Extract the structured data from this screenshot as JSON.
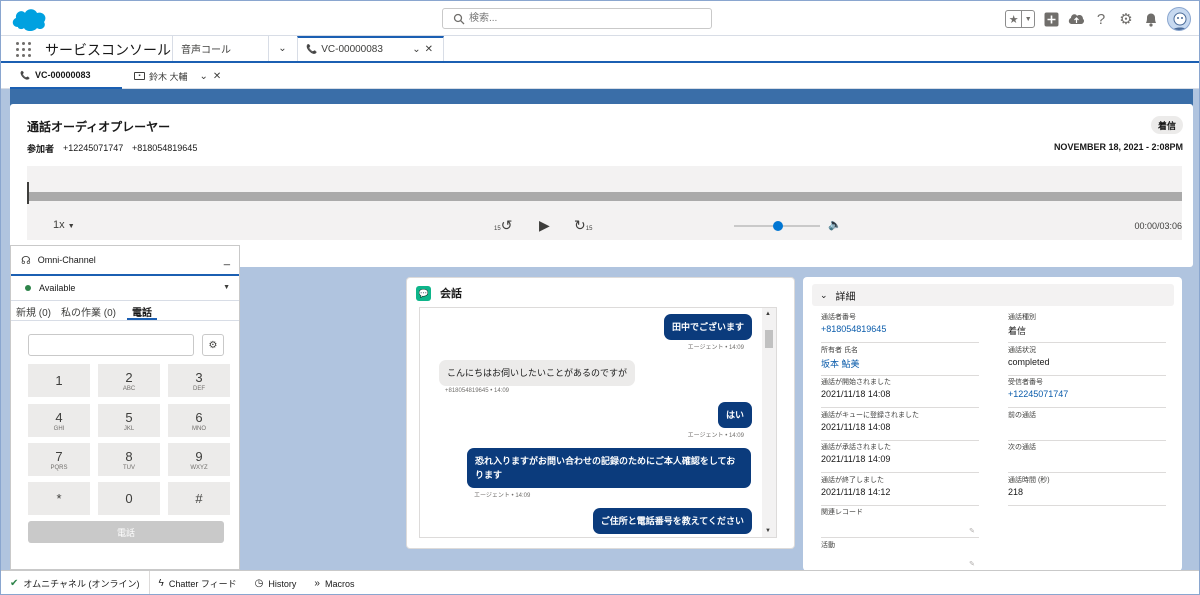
{
  "header": {
    "search_placeholder": "検索..."
  },
  "appnav": {
    "app_name": "サービスコンソール",
    "tabs": [
      {
        "label": "音声コール"
      },
      {
        "label": "VC-00000083"
      }
    ]
  },
  "subtabs": [
    {
      "label": "VC-00000083"
    },
    {
      "label": "鈴木 大輔"
    }
  ],
  "player": {
    "title": "通話オーディオプレーヤー",
    "badge": "着信",
    "participants_label": "参加者",
    "participants": [
      "+12245071747",
      "+818054819645"
    ],
    "date": "NOVEMBER 18, 2021 - 2:08PM",
    "speed": "1x",
    "skip_back": "15",
    "skip_forward": "15",
    "time": "00:00/03:06",
    "progress": 0,
    "volume": 0.5
  },
  "omni": {
    "title": "Omni-Channel",
    "status": "Available",
    "tabs": [
      "新規 (0)",
      "私の作業 (0)",
      "電話"
    ],
    "keys": [
      {
        "digit": "1",
        "letters": ""
      },
      {
        "digit": "2",
        "letters": "ABC"
      },
      {
        "digit": "3",
        "letters": "DEF"
      },
      {
        "digit": "4",
        "letters": "GHI"
      },
      {
        "digit": "5",
        "letters": "JKL"
      },
      {
        "digit": "6",
        "letters": "MNO"
      },
      {
        "digit": "7",
        "letters": "PQRS"
      },
      {
        "digit": "8",
        "letters": "TUV"
      },
      {
        "digit": "9",
        "letters": "WXYZ"
      },
      {
        "digit": "*",
        "letters": ""
      },
      {
        "digit": "0",
        "letters": ""
      },
      {
        "digit": "#",
        "letters": ""
      }
    ],
    "call_label": "電話"
  },
  "conversation": {
    "title": "会話",
    "messages": [
      {
        "dir": "out",
        "text": "田中でございます",
        "meta": "エージェント • 14:09"
      },
      {
        "dir": "in",
        "text": "こんにちはお伺いしたいことがあるのですが",
        "meta": "+818054819645 • 14:09"
      },
      {
        "dir": "out",
        "text": "はい",
        "meta": "エージェント • 14:09"
      },
      {
        "dir": "out",
        "text": "恐れ入りますがお問い合わせの記録のためにご本人確認をしております",
        "meta": "エージェント • 14:09"
      },
      {
        "dir": "out",
        "text": "ご住所と電話番号を教えてください",
        "meta": ""
      }
    ]
  },
  "details": {
    "section": "詳細",
    "left": [
      {
        "label": "通話者番号",
        "value": "+818054819645",
        "link": true
      },
      {
        "label": "所有者 氏名",
        "value": "坂本 鮎美",
        "link": true
      },
      {
        "label": "通話が開始されました",
        "value": "2021/11/18 14:08"
      },
      {
        "label": "通話がキューに登録されました",
        "value": "2021/11/18 14:08"
      },
      {
        "label": "通話が承話されました",
        "value": "2021/11/18 14:09"
      },
      {
        "label": "通話が終了しました",
        "value": "2021/11/18 14:12"
      },
      {
        "label": "関連レコード",
        "value": ""
      },
      {
        "label": "活動",
        "value": ""
      }
    ],
    "right": [
      {
        "label": "通話種別",
        "value": "着信"
      },
      {
        "label": "通話状況",
        "value": "completed"
      },
      {
        "label": "受信者番号",
        "value": "+12245071747",
        "link": true
      },
      {
        "label": "前の通話",
        "value": ""
      },
      {
        "label": "次の通話",
        "value": ""
      },
      {
        "label": "通話時間 (秒)",
        "value": "218"
      }
    ]
  },
  "utility": [
    {
      "label": "オムニチャネル (オンライン)",
      "icon": "check-circle-icon"
    },
    {
      "label": "Chatter フィード",
      "icon": "lightning-icon"
    },
    {
      "label": "History",
      "icon": "clock-icon"
    },
    {
      "label": "Macros",
      "icon": "double-chevron-icon"
    }
  ],
  "colors": {
    "brand": "#1b5fb2",
    "bubble_out": "#0b3b7c",
    "link": "#0b5cab",
    "available": "#2e844a"
  }
}
